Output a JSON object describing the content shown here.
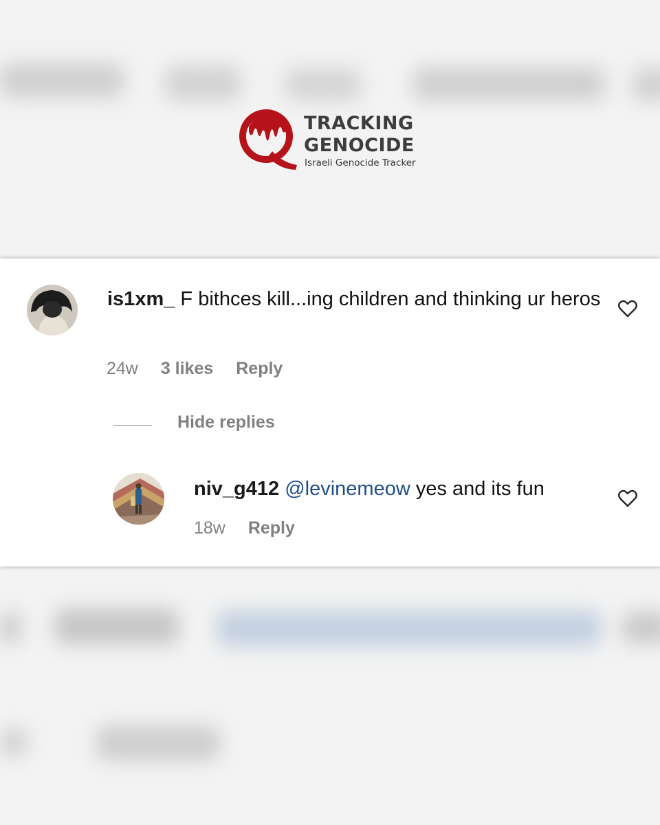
{
  "brand": {
    "title_line1": "TRACKING",
    "title_line2": "GENOCIDE",
    "tagline": "Israeli Genocide Tracker",
    "colors": {
      "mark": "#b5121b",
      "text": "#3d3d3d"
    }
  },
  "comment": {
    "username": "is1xm_",
    "text": "F bithces kill...ing children and thinking ur heros",
    "age": "24w",
    "likes": "3 likes",
    "reply_label": "Reply",
    "avatar_icon": "user-avatar",
    "like_icon": "heart-outline-icon"
  },
  "replies_toggle": {
    "label": "Hide replies"
  },
  "reply": {
    "username": "niv_g412",
    "mention": "@levinemeow",
    "text": "yes and its fun",
    "age": "18w",
    "reply_label": "Reply",
    "avatar_icon": "user-avatar",
    "like_icon": "heart-outline-icon"
  },
  "colors": {
    "mention": "#1d4e89",
    "meta": "#808080",
    "background": "#f3f3f3",
    "card": "#ffffff"
  }
}
